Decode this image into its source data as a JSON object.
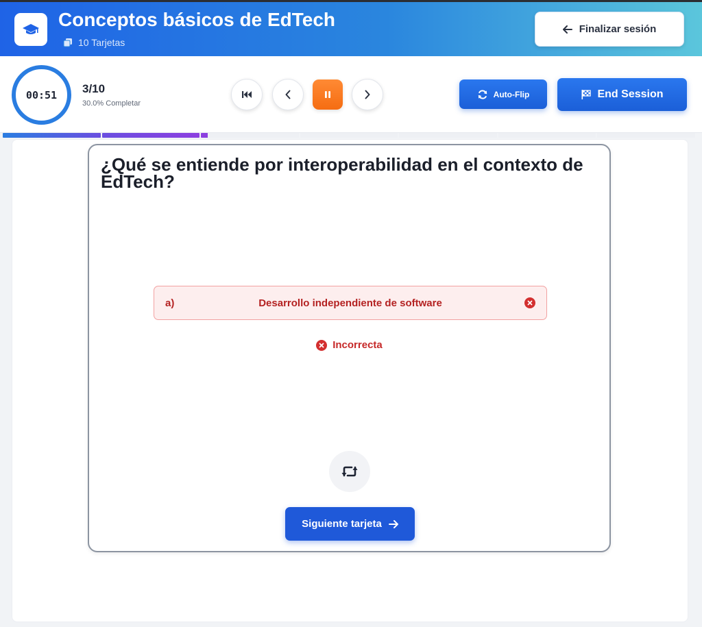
{
  "header": {
    "title": "Conceptos básicos de EdTech",
    "card_count": "10 Tarjetas",
    "finalize_label": "Finalizar sesión"
  },
  "toolbar": {
    "timer": "00:51",
    "progress_count": "3/10",
    "progress_percent_label": "30.0% Completar",
    "autoflip_label": "Auto-Flip",
    "end_session_label": "End Session"
  },
  "progress": {
    "current": 3,
    "total": 10,
    "fraction_complete": 0.3
  },
  "card": {
    "question": "¿Qué se entiende por interoperabilidad en el contexto de EdTech?",
    "option": {
      "letter": "a)",
      "text": "Desarrollo independiente de software",
      "state": "incorrect"
    },
    "status_label": "Incorrecta",
    "next_label": "Siguiente tarjeta"
  },
  "colors": {
    "accent": "#1f59d9",
    "incorrect": "#c62828",
    "pause": "#f56d12"
  },
  "icons": {
    "logo": "graduation-cap-icon",
    "cards": "cards-icon",
    "back": "arrow-left-icon",
    "first": "skip-to-start-icon",
    "prev": "chevron-left-icon",
    "pause": "pause-icon",
    "next": "chevron-right-icon",
    "autoflip": "sync-icon",
    "end": "flag-checkered-icon",
    "wrong": "x-circle-icon",
    "flip": "retweet-icon",
    "forward": "arrow-right-icon"
  }
}
